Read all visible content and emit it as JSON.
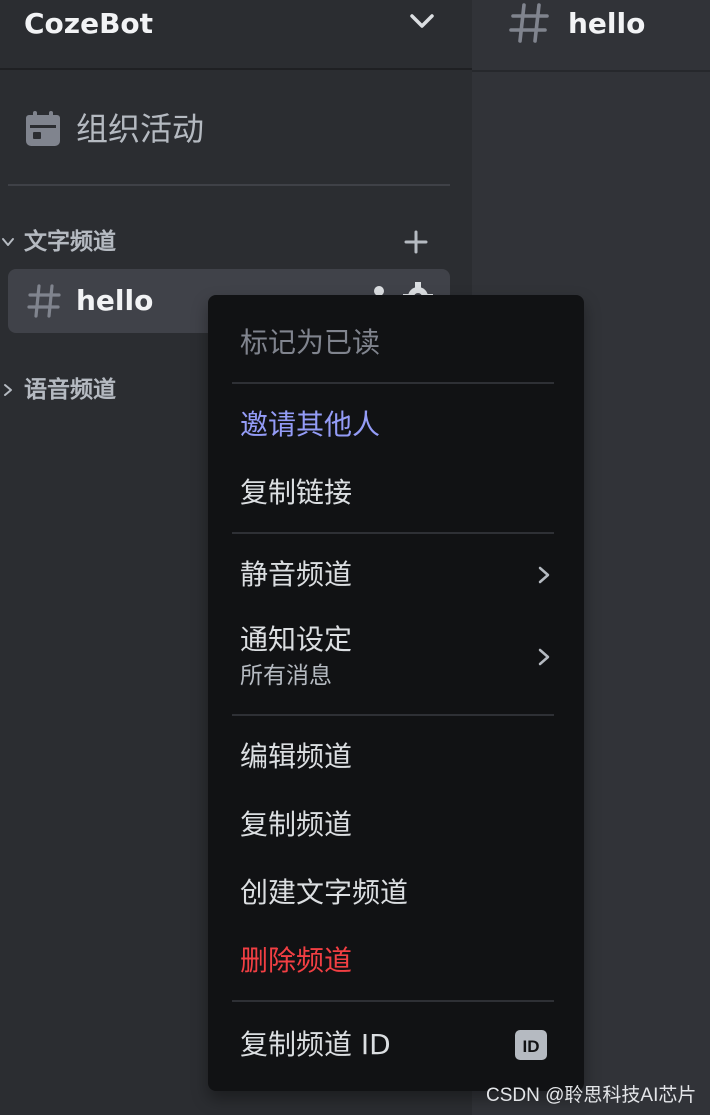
{
  "server": {
    "name": "CozeBot"
  },
  "sidebar": {
    "events_label": "组织活动",
    "text_category": "文字频道",
    "voice_category": "语音频道",
    "selected_channel": "hello"
  },
  "main": {
    "channel_title": "hello"
  },
  "context_menu": {
    "mark_read": "标记为已读",
    "invite": "邀请其他人",
    "copy_link": "复制链接",
    "mute_channel": "静音频道",
    "notification_settings": "通知设定",
    "notification_value": "所有消息",
    "edit_channel": "编辑频道",
    "duplicate_channel": "复制频道",
    "create_text_channel": "创建文字频道",
    "delete_channel": "删除频道",
    "copy_channel_id": "复制频道 ID",
    "id_badge": "ID"
  },
  "watermark": "CSDN @聆思科技AI芯片",
  "colors": {
    "sidebar_bg": "#2b2d31",
    "main_bg": "#313338",
    "menu_bg": "#111214",
    "selected_channel_bg": "#404249",
    "accent_blurple": "#949cf7",
    "danger_red": "#f23f43",
    "muted_text": "#80848e",
    "primary_text": "#dbdee1"
  },
  "icons": {
    "server_menu": "chevron-down-icon",
    "events": "calendar-icon",
    "category_collapse": "chevron-down-icon",
    "category_expand": "chevron-right-icon",
    "add_channel": "plus-icon",
    "channel": "hash-icon",
    "invite": "person-add-icon",
    "settings": "gear-icon",
    "submenu": "chevron-right-icon",
    "copy_id": "id-icon"
  }
}
